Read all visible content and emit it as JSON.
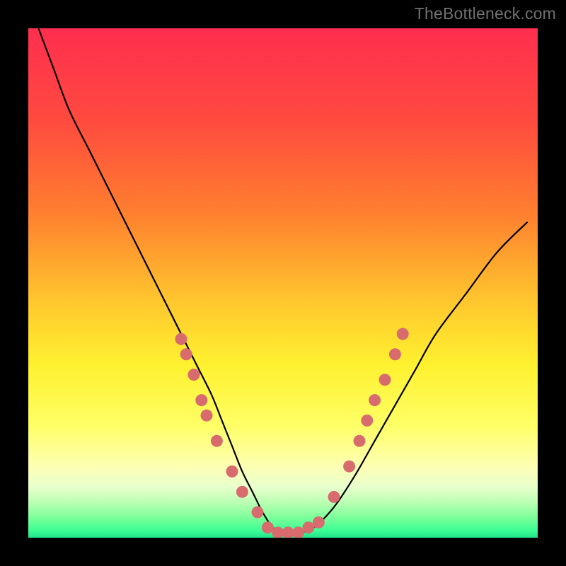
{
  "attribution": "TheBottleneck.com",
  "colors": {
    "background": "#000000",
    "curve_stroke": "#000000",
    "dot_fill": "#d76b6e",
    "gradient_stops": [
      {
        "offset": 0.0,
        "color": "#ff2e4f"
      },
      {
        "offset": 0.18,
        "color": "#ff4a3f"
      },
      {
        "offset": 0.36,
        "color": "#ff7e2f"
      },
      {
        "offset": 0.54,
        "color": "#ffc82e"
      },
      {
        "offset": 0.66,
        "color": "#fff12f"
      },
      {
        "offset": 0.78,
        "color": "#ffff66"
      },
      {
        "offset": 0.86,
        "color": "#fdffb3"
      },
      {
        "offset": 0.9,
        "color": "#e9ffcc"
      },
      {
        "offset": 0.93,
        "color": "#bcffb4"
      },
      {
        "offset": 0.96,
        "color": "#7dff9a"
      },
      {
        "offset": 0.985,
        "color": "#3dff94"
      },
      {
        "offset": 1.0,
        "color": "#22e38e"
      }
    ]
  },
  "chart_data": {
    "type": "line",
    "title": "",
    "xlabel": "",
    "ylabel": "",
    "xlim": [
      0,
      100
    ],
    "ylim": [
      0,
      100
    ],
    "grid": false,
    "legend": false,
    "series": [
      {
        "name": "bottleneck-curve",
        "x": [
          2,
          5,
          8,
          12,
          16,
          20,
          24,
          27,
          30,
          33,
          36,
          38,
          40,
          42,
          44,
          46,
          48,
          50,
          53,
          56,
          60,
          64,
          68,
          72,
          76,
          80,
          86,
          92,
          98
        ],
        "y": [
          100,
          92,
          84,
          76,
          68,
          60,
          52,
          46,
          40,
          34,
          28,
          23,
          18,
          13,
          9,
          5,
          2,
          1,
          1,
          2,
          6,
          12,
          19,
          26,
          33,
          40,
          48,
          56,
          62
        ]
      }
    ],
    "dots": [
      {
        "x": 30.0,
        "y": 39
      },
      {
        "x": 31.0,
        "y": 36
      },
      {
        "x": 32.5,
        "y": 32
      },
      {
        "x": 34.0,
        "y": 27
      },
      {
        "x": 35.0,
        "y": 24
      },
      {
        "x": 37.0,
        "y": 19
      },
      {
        "x": 40.0,
        "y": 13
      },
      {
        "x": 42.0,
        "y": 9
      },
      {
        "x": 45.0,
        "y": 5
      },
      {
        "x": 47.0,
        "y": 2
      },
      {
        "x": 49.0,
        "y": 1
      },
      {
        "x": 51.0,
        "y": 1
      },
      {
        "x": 53.0,
        "y": 1
      },
      {
        "x": 55.0,
        "y": 2
      },
      {
        "x": 57.0,
        "y": 3
      },
      {
        "x": 60.0,
        "y": 8
      },
      {
        "x": 63.0,
        "y": 14
      },
      {
        "x": 65.0,
        "y": 19
      },
      {
        "x": 66.5,
        "y": 23
      },
      {
        "x": 68.0,
        "y": 27
      },
      {
        "x": 70.0,
        "y": 31
      },
      {
        "x": 72.0,
        "y": 36
      },
      {
        "x": 73.5,
        "y": 40
      }
    ]
  }
}
